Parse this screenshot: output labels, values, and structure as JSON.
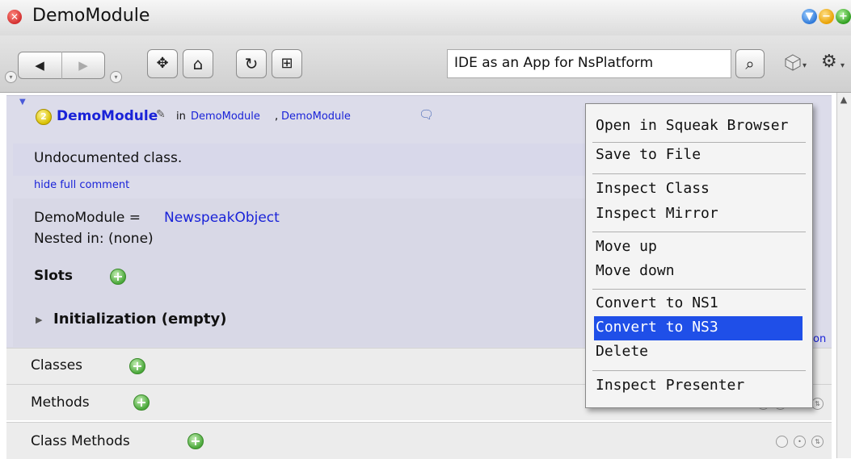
{
  "window": {
    "title": "DemoModule",
    "close_glyph": "✕",
    "button_glyphs": [
      "▼",
      "−",
      "+"
    ]
  },
  "toolbar": {
    "back_glyph": "◀",
    "forward_glyph": "▶",
    "move_glyph": "✥",
    "home_glyph": "⌂",
    "refresh_glyph": "↻",
    "new_window_glyph": "⊞",
    "search_value": "IDE as an App for NsPlatform",
    "search_glyph": "⌕",
    "dropdown_glyph": "▾"
  },
  "module": {
    "name": "DemoModule",
    "in_label": "in",
    "path_1": "DemoModule",
    "path_sep": ",",
    "path_2": "DemoModule",
    "number_badge": "2",
    "comment": "Undocumented class.",
    "hide_comment_link": "hide full comment",
    "superclass_prefix": "DemoModule =",
    "superclass": "NewspeakObject",
    "nested_in": "Nested in: (none)",
    "slots_label": "Slots",
    "init_label": "Initialization (empty)",
    "partial_text": "on"
  },
  "rows": [
    {
      "label": "Classes"
    },
    {
      "label": "Methods"
    },
    {
      "label": "Class Methods"
    }
  ],
  "plus_glyph": "+",
  "context_menu": {
    "items": [
      "Open in Squeak Browser",
      "Save to File",
      "Inspect Class",
      "Inspect Mirror",
      "Move up",
      "Move down",
      "Convert to NS1",
      "Convert to NS3",
      "Delete",
      "Inspect Presenter"
    ],
    "highlighted": "Convert to NS3"
  },
  "colors": {
    "accent_highlight": "#1f4fe8",
    "link": "#1a23d8",
    "panel_bg": "#dcdcea"
  }
}
